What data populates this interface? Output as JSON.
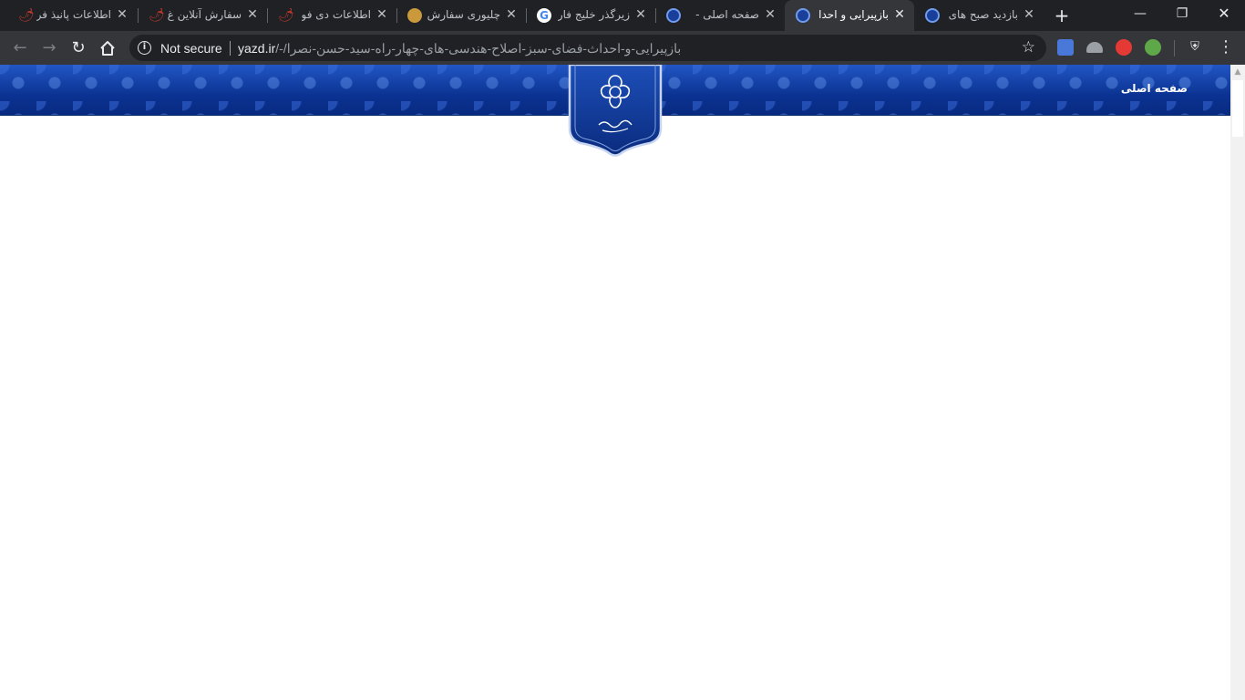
{
  "browser": {
    "tabs": [
      {
        "title": "اطلاعات پانیذ فر",
        "favicon": "red-chili-icon",
        "active": false
      },
      {
        "title": "سفارش آنلاین غ",
        "favicon": "red-chili-icon",
        "active": false
      },
      {
        "title": "اطلاعات دی فو",
        "favicon": "red-chili-icon",
        "active": false
      },
      {
        "title": "چلیوری سفارش",
        "favicon": "food-bowl-icon",
        "active": false
      },
      {
        "title": "زیرگذر خلیج فار",
        "favicon": "google-icon",
        "active": false
      },
      {
        "title": "صفحه اصلی - ",
        "favicon": "yazd-emblem-icon",
        "active": false
      },
      {
        "title": "بازپیرایی و احدا",
        "favicon": "yazd-emblem-icon",
        "active": true
      },
      {
        "title": "بازدید صبح های",
        "favicon": "yazd-emblem-icon",
        "active": false
      }
    ],
    "new_tab_label": "+",
    "window_controls": {
      "minimize": "—",
      "restore": "❐",
      "close": "✕"
    },
    "toolbar": {
      "security_label": "Not secure",
      "url_host": "yazd.ir",
      "url_path": "/-/بازپیرایی-و-احداث-فضای-سبز-اصلاح-هندسی-های-چهار-راه-سید-حسن-نصرا"
    }
  },
  "site": {
    "home_link": "صفحه اصلی",
    "colors": {
      "header_blue": "#0e3a9a",
      "header_highlight": "#2256c4"
    }
  }
}
